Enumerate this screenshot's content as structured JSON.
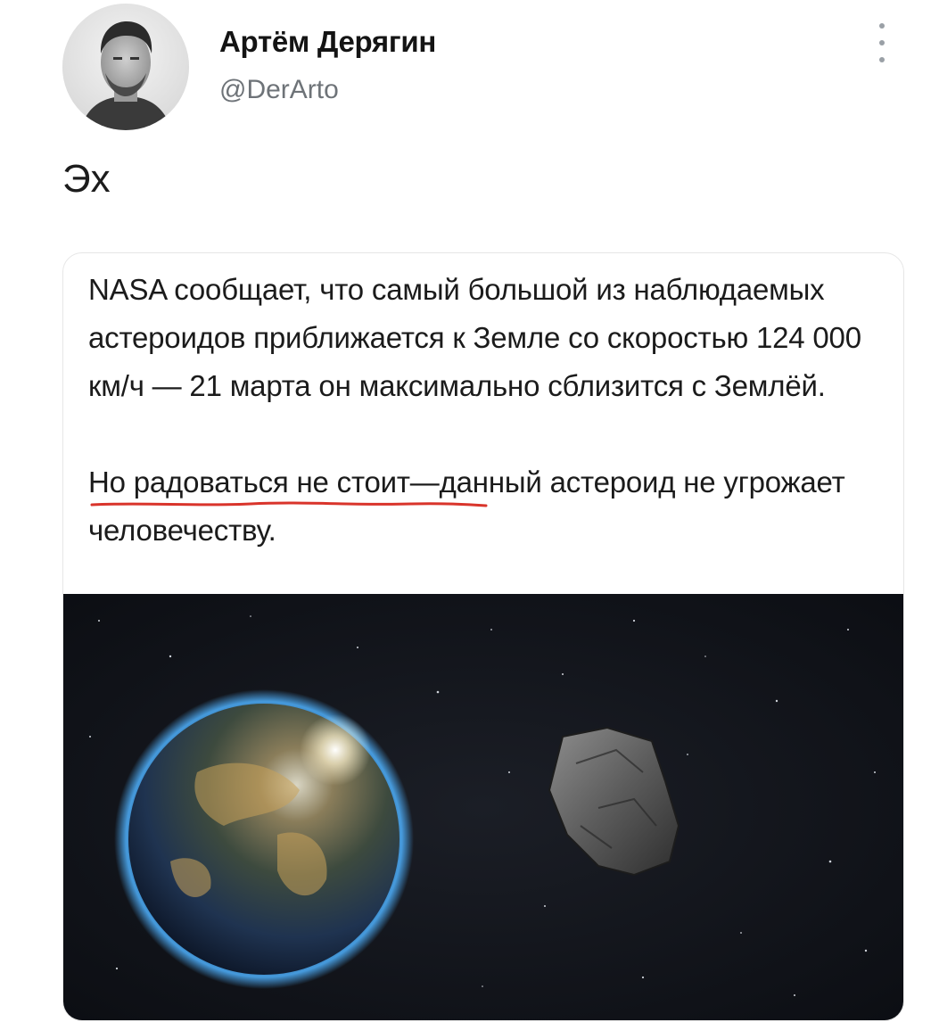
{
  "author": {
    "name": "Артём Дерягин",
    "handle": "@DerArto",
    "avatar_icon": "user-avatar-photo"
  },
  "tweet": {
    "text": "Эх"
  },
  "quoted_card": {
    "paragraph1": "NASA сообщает, что самый большой из наблюдаемых астероидов приближается к Земле со скоростью 124 000 км/ч — 21 марта он максимально сблизится с Землёй.",
    "paragraph2": "Но радоваться не стоит—данный астероид не угрожает человечеству.",
    "underline_color": "#d9342b"
  },
  "image": {
    "subject": "earth-and-asteroid-in-space"
  },
  "icons": {
    "more": "more-vertical-icon"
  }
}
